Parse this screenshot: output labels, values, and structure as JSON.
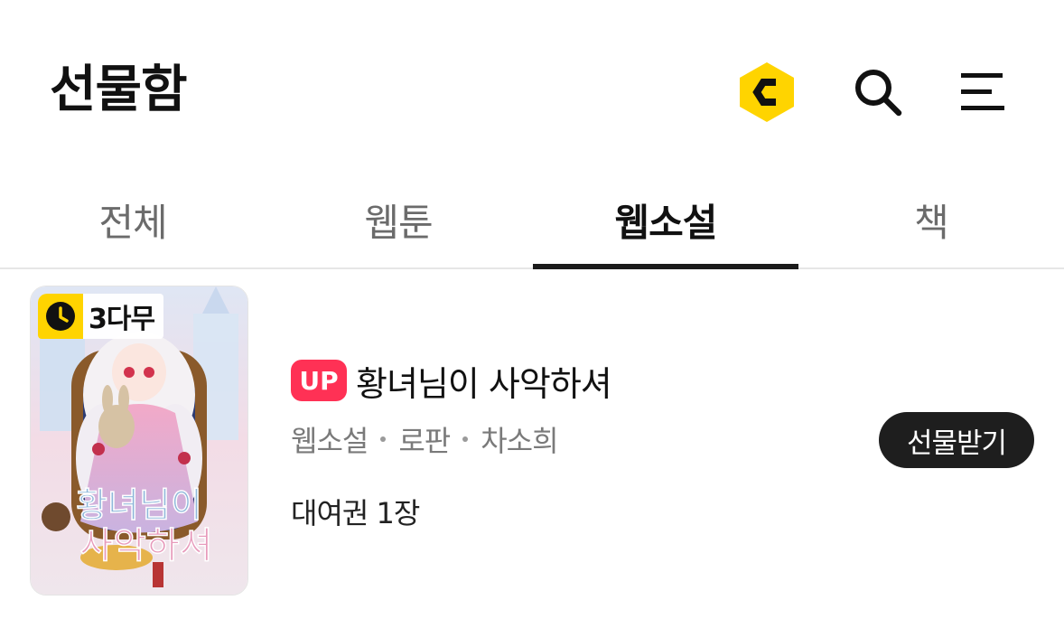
{
  "header": {
    "title": "선물함",
    "icons": [
      "coin-icon",
      "search-icon",
      "menu-icon"
    ],
    "coin_color": "#ffd400"
  },
  "tabs": [
    {
      "label": "전체",
      "active": false
    },
    {
      "label": "웹툰",
      "active": false
    },
    {
      "label": "웹소설",
      "active": true
    },
    {
      "label": "책",
      "active": false
    }
  ],
  "gift_item": {
    "wait_badge": "3다무",
    "up_label": "UP",
    "title": "황녀님이 사악하셔",
    "meta": {
      "category": "웹소설",
      "genre": "로판",
      "author": "차소희"
    },
    "rental": "대여권 1장",
    "receive_label": "선물받기",
    "cover_alt": "황녀님이 사악하셔 cover",
    "cover_text": "황녀님이 사악하셔"
  },
  "colors": {
    "up_badge": "#ff3155",
    "receive_button": "#1e1e1e",
    "active_tab": "#111111",
    "inactive_tab": "#6b6b6b"
  }
}
